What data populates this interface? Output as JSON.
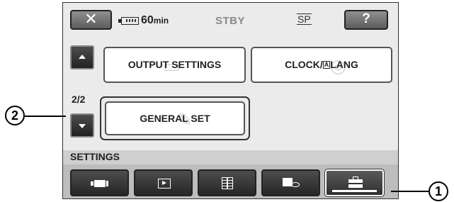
{
  "header": {
    "close_symbol": "✕",
    "battery_value": "60",
    "battery_unit": "min",
    "status": "STBY",
    "mode": "SP",
    "help_symbol": "?"
  },
  "navigation": {
    "page_indicator": "2/2"
  },
  "menu": {
    "output_settings": "OUTPUT SETTINGS",
    "clock_lang_before": "CLOCK/",
    "clock_lang_glyph": "A",
    "clock_lang_after": "LANG",
    "general_set": "GENERAL SET"
  },
  "settings": {
    "label": "SETTINGS",
    "tabs": [
      "camera-settings-tab",
      "playback-settings-tab",
      "edit-list-tab",
      "tape-settings-tab",
      "general-settings-tab"
    ],
    "active_tab": "general-settings-tab"
  },
  "callouts": {
    "one": "1",
    "two": "2"
  },
  "colors": {
    "screen_bg": "#ebebeb",
    "button_dark": "#3a3a3a",
    "status_grey": "#8a8a8a"
  }
}
